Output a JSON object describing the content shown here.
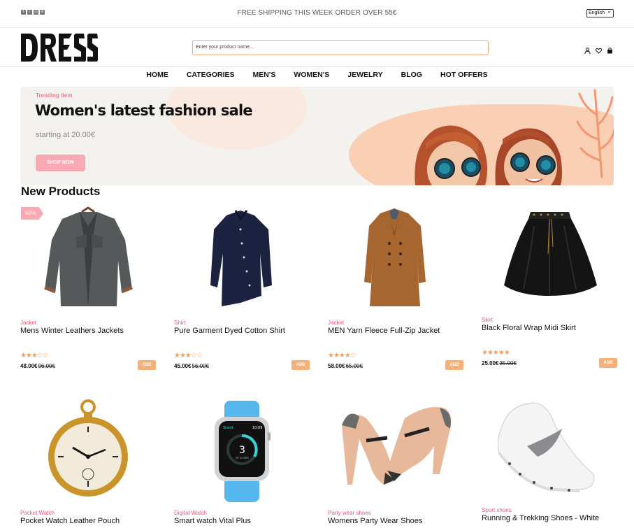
{
  "topbar": {
    "social_icons": [
      "facebook-icon",
      "twitter-icon",
      "instagram-icon",
      "linkedin-icon"
    ],
    "shipping_text": "FREE SHIPPING THIS WEEK ORDER OVER 55€",
    "language": "English"
  },
  "header": {
    "logo_text": "DRESS",
    "search_placeholder": "Enter your product name...",
    "icons": [
      "user-icon",
      "heart-icon",
      "bag-icon"
    ]
  },
  "nav": [
    "HOME",
    "CATEGORIES",
    "MEN'S",
    "WOMEN'S",
    "JEWELRY",
    "BLOG",
    "HOT OFFERS"
  ],
  "banner": {
    "tag": "Trending item",
    "headline": "Women's latest fashion sale",
    "price": "starting at 20.00€",
    "button": "SHOP NOW"
  },
  "section_title": "New Products",
  "colors": {
    "accent_pink": "#f9a9b1",
    "accent_orange": "#f7b076",
    "category": "#f0557a"
  },
  "products": [
    {
      "badge": "50%",
      "category": "Jacket",
      "name": "Mens Winter Leathers Jackets",
      "rating": 3,
      "price": "48.00€",
      "old_price": "96.00€",
      "add": "ADD"
    },
    {
      "category": "Shirt",
      "name": "Pure Garment Dyed Cotton Shirt",
      "rating": 3,
      "price": "45.00€",
      "old_price": "56.00€",
      "add": "ADD"
    },
    {
      "category": "Jacket",
      "name": "MEN Yarn Fleece Full-Zip Jacket",
      "rating": 4,
      "price": "58.00€",
      "old_price": "65.00€",
      "add": "ADD"
    },
    {
      "category": "Skirt",
      "name": "Black Floral Wrap Midi Skirt",
      "rating": 5,
      "price": "25.00€",
      "old_price": "35.00€",
      "add": "ADD"
    },
    {
      "category": "Pocket Watch",
      "name": "Pocket Watch Leather Pouch"
    },
    {
      "category": "Digital Watch",
      "name": "Smart watch Vital Plus"
    },
    {
      "category": "Party wear shoes",
      "name": "Womens Party Wear Shoes"
    },
    {
      "category": "Sport shoes",
      "name": "Running & Trekking Shoes - White"
    }
  ],
  "watch_screen": {
    "label": "Stand",
    "time": "10:09",
    "number": "3",
    "sub": "OF 12 HRS"
  }
}
